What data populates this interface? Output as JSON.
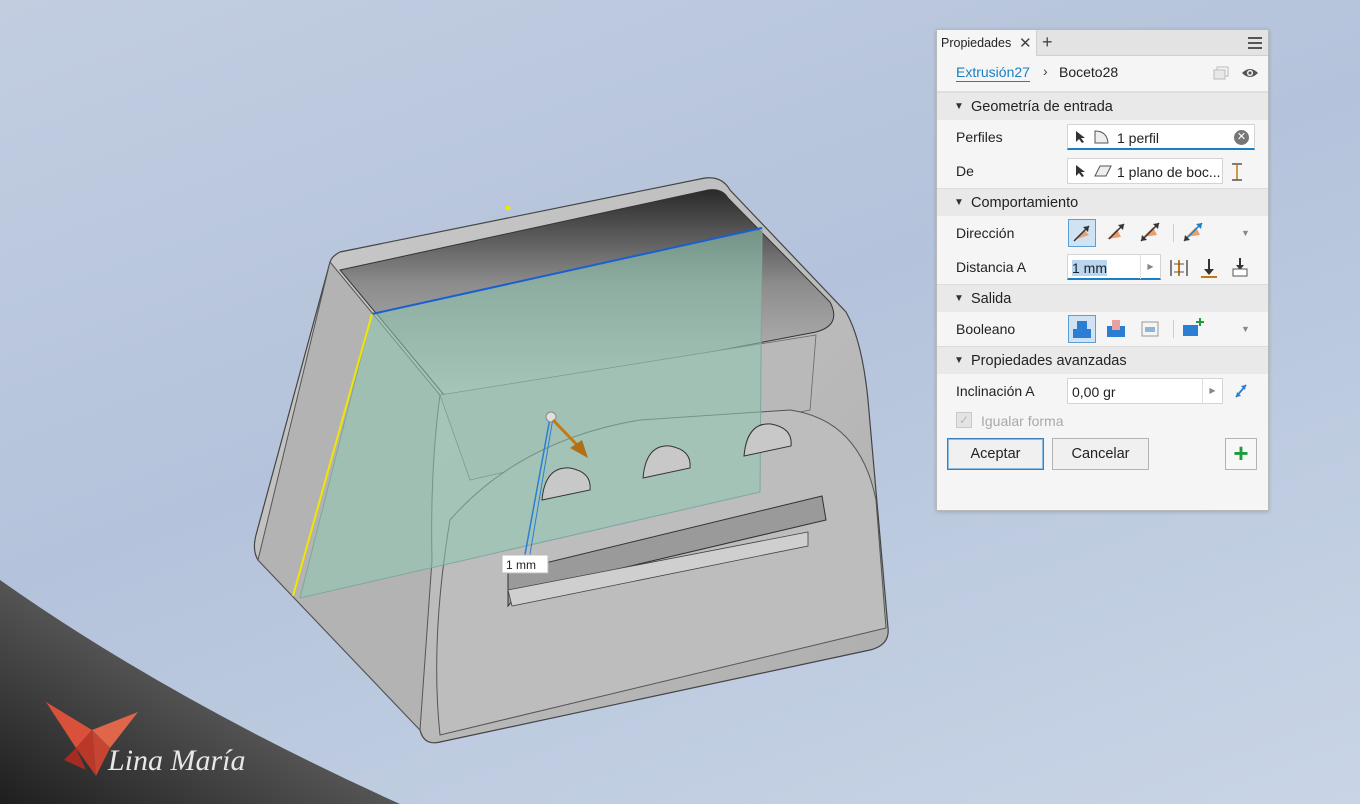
{
  "viewport": {
    "dimension_label": "1 mm",
    "watermark_text": "Lina María"
  },
  "panel": {
    "tab_label": "Propiedades",
    "breadcrumb": {
      "link": "Extrusión27",
      "current": "Boceto28"
    },
    "sections": {
      "input_geometry": "Geometría de entrada",
      "behavior": "Comportamiento",
      "output": "Salida",
      "advanced": "Propiedades avanzadas"
    },
    "fields": {
      "profiles_label": "Perfiles",
      "profiles_value": "1 perfil",
      "from_label": "De",
      "from_value": "1 plano de boc...",
      "direction_label": "Dirección",
      "distance_label": "Distancia A",
      "distance_value": "1 mm",
      "boolean_label": "Booleano",
      "taper_label": "Inclinación A",
      "taper_value": "0,00 gr",
      "match_shape_label": "Igualar forma"
    },
    "buttons": {
      "ok": "Aceptar",
      "cancel": "Cancelar"
    }
  },
  "icons": [
    "close-icon",
    "plus-icon",
    "menu-icon",
    "stack-icon",
    "eye-icon",
    "cursor-icon",
    "profile-icon",
    "plane-icon",
    "extents-icon",
    "direction-default-icon",
    "direction-flip-icon",
    "direction-symmetric-icon",
    "direction-asymmetric-icon",
    "distance-mode-icon",
    "to-icon",
    "to-next-icon",
    "join-icon",
    "cut-icon",
    "intersect-icon",
    "new-body-icon",
    "flip-taper-icon"
  ]
}
